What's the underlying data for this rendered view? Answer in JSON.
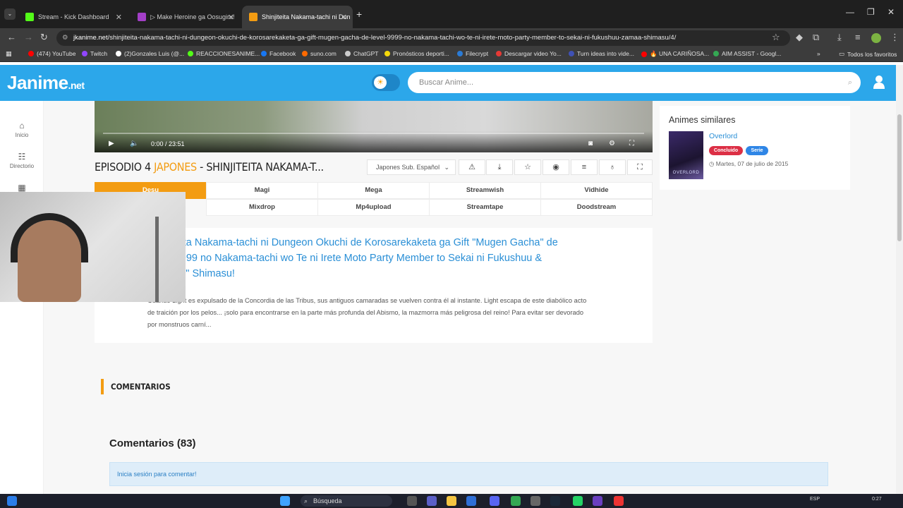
{
  "browser": {
    "tabs": [
      {
        "label": "Stream - Kick Dashboard",
        "color": "#53fc18"
      },
      {
        "label": "▷ Make Heroine ga Oosugiru!",
        "color": "#a33fc7"
      },
      {
        "label": "Shinjiteita Nakama-tachi ni Dun",
        "color": "#f39c12"
      }
    ],
    "new_tab": "+",
    "url_domain": "jkanime.net",
    "url_path": "/shinjiteita-nakama-tachi-ni-dungeon-okuchi-de-korosarekaketa-ga-gift-mugen-gacha-de-level-9999-no-nakama-tachi-wo-te-ni-irete-moto-party-member-to-sekai-ni-fukushuu-zamaa-shimasu/4/",
    "bookmarks": [
      {
        "label": "(474) YouTube",
        "color": "#ff0000"
      },
      {
        "label": "Twitch",
        "color": "#9146ff"
      },
      {
        "label": "(2)Gonzales Luis (@...",
        "color": "#ffffff"
      },
      {
        "label": "REACCIONESANIME...",
        "color": "#53fc18"
      },
      {
        "label": "Facebook",
        "color": "#1877f2"
      },
      {
        "label": "suno.com",
        "color": "#ff6a00"
      },
      {
        "label": "ChatGPT",
        "color": "#cccccc"
      },
      {
        "label": "Pronósticos deporti...",
        "color": "#f5d90a"
      },
      {
        "label": "Filecrypt",
        "color": "#2a7bd6"
      },
      {
        "label": "Descargar video Yo...",
        "color": "#e53935"
      },
      {
        "label": "Turn ideas into vide...",
        "color": "#3f51b5"
      },
      {
        "label": "🔥 UNA CARIÑOSA...",
        "color": "#ff0000"
      },
      {
        "label": "AIM ASSIST - Googl...",
        "color": "#34a853"
      }
    ],
    "all_bookmarks": "Todos los favoritos"
  },
  "site": {
    "logo_main": "Janime",
    "logo_suffix": ".net",
    "search_placeholder": "Buscar Anime...",
    "sidenav": [
      {
        "label": "Inicio",
        "icon": "⌂"
      },
      {
        "label": "Directorio",
        "icon": "☷"
      }
    ]
  },
  "player": {
    "time": "0:00 / 23:51"
  },
  "episode": {
    "prefix": "EPISODIO 4",
    "lang": "JAPONES",
    "title": "- SHINJITEITA NAKAMA-T...",
    "lang_select": "Japones Sub. Español"
  },
  "servers": {
    "row1": [
      "Desu",
      "Magi",
      "Mega",
      "Streamwish",
      "Vidhide"
    ],
    "row2": [
      "Mixdrop",
      "Mp4upload",
      "Streamtape",
      "Doodstream"
    ]
  },
  "synopsis": {
    "title": "Shinjiteita Nakama-tachi ni Dungeon Okuchi de Korosarekaketa ga Gift \"Mugen Gacha\" de Level 9999 no Nakama-tachi wo Te ni Irete Moto Party Member to Sekai ni Fukushuu & \"Zamaa!\" Shimasu!",
    "text": "Cuando Light es expulsado de la Concordia de las Tribus, sus antiguos camaradas se vuelven contra él al instante. Light escapa de este diabólico acto de traición por los pelos... ¡solo para encontrarse en la parte más profunda del Abismo, la mazmorra más peligrosa del reino! Para evitar ser devorado por monstruos carní..."
  },
  "comments": {
    "section_label": "COMENTARIOS",
    "count_title": "Comentarios (83)",
    "login_prompt": "Inicia sesión para comentar!"
  },
  "similar": {
    "heading": "Animes similares",
    "poster_text": "OVERLORD",
    "name": "Overlord",
    "badge_status": "Concluido",
    "badge_type": "Serie",
    "date": "Martes, 07 de julio de 2015"
  },
  "taskbar": {
    "search": "Búsqueda",
    "lang": "ESP",
    "time": "0:27"
  }
}
